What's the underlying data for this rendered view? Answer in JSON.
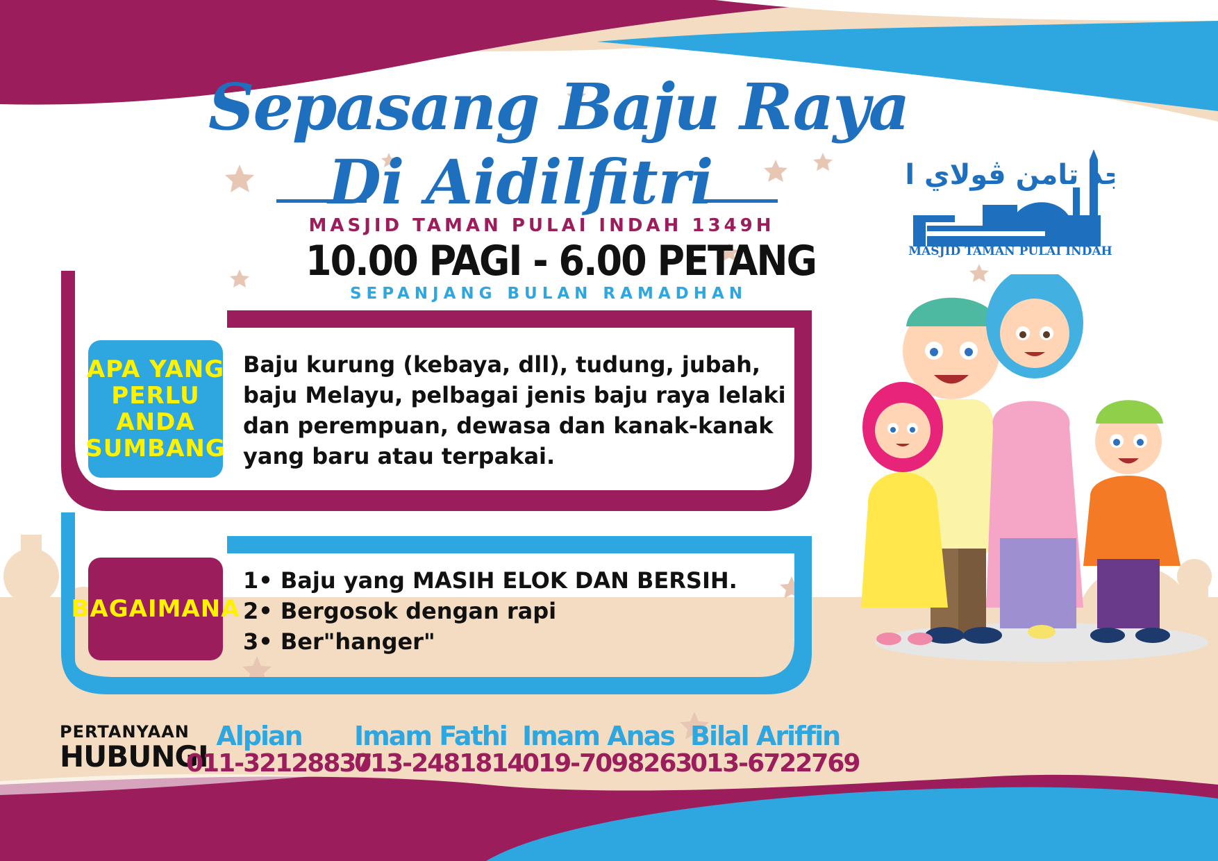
{
  "title": {
    "line1": "Sepasang Baju Raya",
    "line2": "Di Aidilfitri"
  },
  "subtitle": "MASJID TAMAN PULAI  INDAH 1349H",
  "time": "10.00 PAGI - 6.00 PETANG",
  "period": "SEPANJANG BULAN RAMADHAN",
  "section1": {
    "label": "APA YANG\nPERLU ANDA\nSUMBANG",
    "text": "Baju kurung (kebaya, dll), tudung, jubah, baju Melayu, pelbagai jenis baju raya lelaki dan perempuan, dewasa dan kanak-kanak yang baru atau terpakai."
  },
  "section2": {
    "label": "BAGAIMANA",
    "items": [
      "1• Baju yang MASIH ELOK DAN BERSIH.",
      "2• Bergosok dengan rapi",
      "3• Ber\"hanger\""
    ]
  },
  "contact": {
    "label_small": "PERTANYAAN",
    "label_big": "HUBUNGI",
    "people": [
      {
        "name": "Alpian",
        "phone": "011-32128837"
      },
      {
        "name": "Imam Fathi",
        "phone": "013-2481814"
      },
      {
        "name": "Imam Anas",
        "phone": "019-7098263"
      },
      {
        "name": "Bilal Ariffin",
        "phone": "013-6722769"
      }
    ]
  },
  "logo": {
    "arabic": "مسجد تامن ڤولاي ايندة",
    "caption": "MASJID TAMAN PULAI INDAH"
  },
  "colors": {
    "magenta": "#9b1d5b",
    "blue": "#2ea6df",
    "dark_blue": "#1f6fbf",
    "yellow": "#fff200",
    "beige": "#f3dcc2"
  }
}
